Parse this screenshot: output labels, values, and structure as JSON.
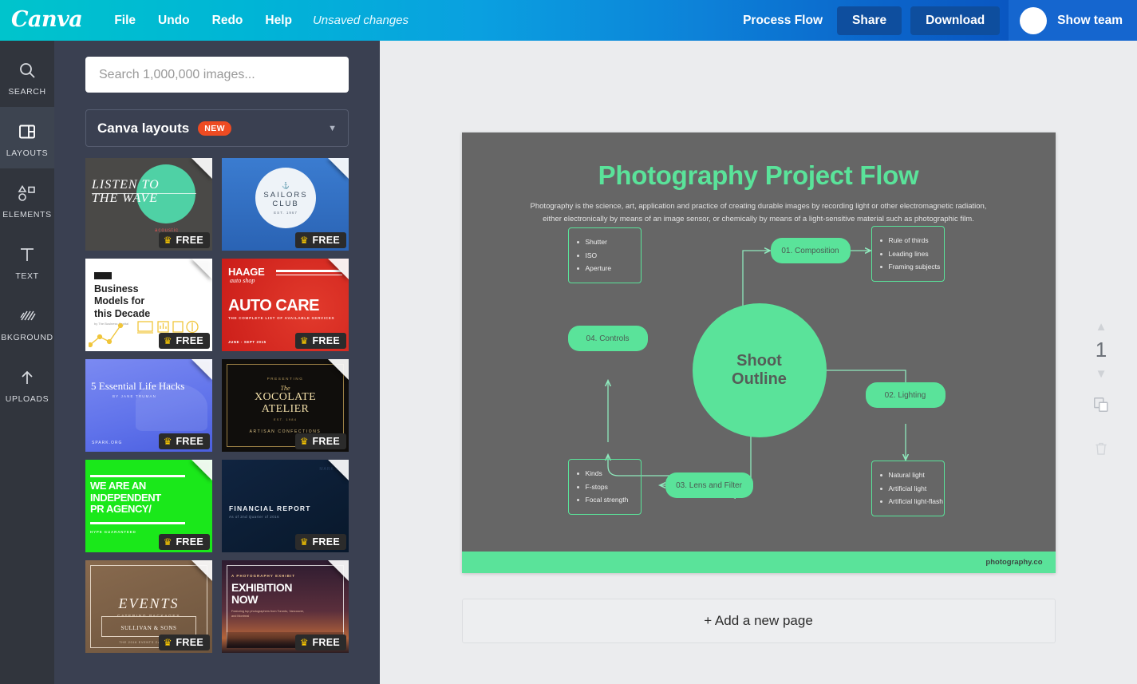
{
  "header": {
    "logo": "Canva",
    "menu": [
      "File",
      "Undo",
      "Redo",
      "Help"
    ],
    "unsaved_status": "Unsaved changes",
    "doc_title": "Process Flow",
    "share_label": "Share",
    "download_label": "Download",
    "team_label": "Show team",
    "accent_teal": "#00c4cc",
    "accent_blue": "#0e4e9e"
  },
  "rail": {
    "items": [
      {
        "label": "SEARCH",
        "icon": "search-icon",
        "active": false
      },
      {
        "label": "LAYOUTS",
        "icon": "layouts-icon",
        "active": true
      },
      {
        "label": "ELEMENTS",
        "icon": "elements-icon",
        "active": false
      },
      {
        "label": "TEXT",
        "icon": "text-icon",
        "active": false
      },
      {
        "label": "BKGROUND",
        "icon": "background-icon",
        "active": false
      },
      {
        "label": "UPLOADS",
        "icon": "uploads-icon",
        "active": false
      }
    ]
  },
  "panel": {
    "search_placeholder": "Search 1,000,000 images...",
    "search_value": "",
    "dropdown_label": "Canva layouts",
    "dropdown_badge": "NEW",
    "free_label": "FREE",
    "thumbnails": [
      {
        "id": "listen-to-the-wave",
        "title": "LISTEN TO THE WAVE",
        "sub": "",
        "badge": "FREE"
      },
      {
        "id": "sailors-club",
        "title": "SAILORS CLUB",
        "sub": "EST. 1967",
        "badge": "FREE"
      },
      {
        "id": "business-models",
        "title": "Business Models for this Decade",
        "sub": "by The Business Capital",
        "badge": "FREE"
      },
      {
        "id": "haage-auto-care",
        "title": "AUTO CARE",
        "sub": "THE COMPLETE LIST OF AVAILABLE SERVICES",
        "badge": "FREE"
      },
      {
        "id": "life-hacks",
        "title": "5 Essential Life Hacks",
        "sub": "BY JANE TRUMAN",
        "badge": "FREE"
      },
      {
        "id": "xocolate-atelier",
        "title": "XOCOLATE ATELIER",
        "sub": "ARTISAN CONFECTIONS",
        "badge": "FREE"
      },
      {
        "id": "pr-agency",
        "title": "WE ARE AN INDEPENDENT PR AGENCY/",
        "sub": "HYPE GUARANTEED",
        "badge": "FREE"
      },
      {
        "id": "financial-report",
        "title": "FINANCIAL REPORT",
        "sub": "As of 2nd Quarter of 2016",
        "badge": "FREE"
      },
      {
        "id": "events-catering",
        "title": "EVENTS",
        "sub": "CATERING PACKAGES",
        "badge": "FREE"
      },
      {
        "id": "exhibition-now",
        "title": "EXHIBITION NOW",
        "sub": "A PHOTOGRAPHY EXHIBIT",
        "badge": "FREE"
      }
    ],
    "thumb_text": {
      "t0_line1": "LISTEN TO",
      "t0_line2": "THE WAVE",
      "t1_line1": "SAILORS",
      "t1_line2": "CLUB",
      "t1_est": "EST. 1967",
      "t2_line1": "Business",
      "t2_line2": "Models for",
      "t2_line3": "this Decade",
      "t2_by": "by The Business Capital",
      "t3_brand": "HAAGE",
      "t3_script": "auto shop",
      "t3_title": "AUTO CARE",
      "t3_sub": "THE COMPLETE LIST OF AVAILABLE SERVICES",
      "t3_date": "JUNE - SEPT 2015",
      "t4_title": "5 Essential Life Hacks",
      "t4_by": "BY JANE TRUMAN",
      "t4_org": "SPARK.ORG",
      "t5_presenting": "PRESENTING",
      "t5_the": "The",
      "t5_line1": "XOCOLATE",
      "t5_line2": "ATELIER",
      "t5_est": "EST. 1984",
      "t5_sub": "ARTISAN CONFECTIONS",
      "t6_line1": "WE ARE AN",
      "t6_line2": "INDEPENDENT",
      "t6_line3": "PR AGENCY/",
      "t6_sub": "HYPE GUARANTEED",
      "t7_title": "FINANCIAL REPORT",
      "t7_sub": "As of 2nd Quarter of 2016",
      "t8_title": "EVENTS",
      "t8_sub": "CATERING PACKAGES",
      "t8_name": "SULLIVAN & SONS",
      "t8_foot": "THE 2016 EVENTS CATALOGUE",
      "t9_kicker": "A PHOTOGRAPHY EXHIBIT",
      "t9_line1": "EXHIBITION",
      "t9_line2": "NOW",
      "t9_sub": "Featuring top photographers from Toronto, Vancouver, and Montreal"
    }
  },
  "canvas": {
    "add_page_label": "+ Add a new page",
    "page_number": "1",
    "tools": {
      "move_up": "chevron-up-icon",
      "move_down": "chevron-down-icon",
      "duplicate": "duplicate-icon",
      "delete": "trash-icon"
    },
    "design": {
      "title": "Photography Project Flow",
      "subtitle_line1": "Photography is the science, art, application and practice of creating durable images by recording light or other electromagnetic radiation,",
      "subtitle_line2": "either electronically by means of an image sensor, or chemically by means of a light-sensitive material such as photographic film.",
      "footer_url": "photography.co",
      "hub_line1": "Shoot",
      "hub_line2": "Outline",
      "bg_color": "#666666",
      "accent_color": "#5ae39a",
      "nodes": [
        {
          "id": "composition",
          "label": "01. Composition"
        },
        {
          "id": "lighting",
          "label": "02. Lighting"
        },
        {
          "id": "lens",
          "label": "03. Lens and Filter"
        },
        {
          "id": "controls",
          "label": "04. Controls"
        }
      ],
      "detail_boxes": [
        {
          "id": "controls-details",
          "items": [
            "Shutter",
            "ISO",
            "Aperture"
          ]
        },
        {
          "id": "composition-details",
          "items": [
            "Rule of thirds",
            "Leading lines",
            "Framing subjects"
          ]
        },
        {
          "id": "lighting-details",
          "items": [
            "Natural light",
            "Artificial light",
            "Artificial light-flash"
          ]
        },
        {
          "id": "lens-details",
          "items": [
            "Kinds",
            "F-stops",
            "Focal strength"
          ]
        }
      ]
    }
  }
}
